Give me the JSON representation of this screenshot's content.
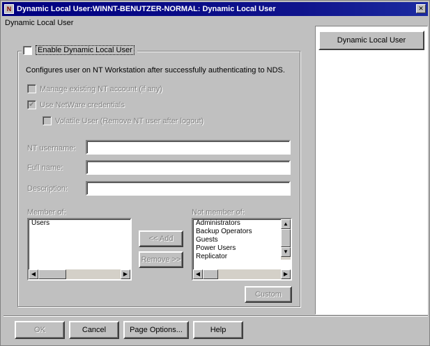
{
  "window": {
    "title": "Dynamic Local User:WINNT-BENUTZER-NORMAL: Dynamic Local User"
  },
  "panel": {
    "label": "Dynamic Local User"
  },
  "enable_checkbox": {
    "label": "Enable Dynamic Local User",
    "checked": false
  },
  "description": "Configures user on NT Workstation after successfully authenticating to NDS.",
  "options": {
    "manage_existing_label": "Manage existing NT account (if any)",
    "manage_existing_checked": false,
    "use_netware_label": "Use NetWare credentials",
    "use_netware_checked": true,
    "volatile_label": "Volatile User (Remove NT user after logout)",
    "volatile_checked": false
  },
  "fields": {
    "nt_username_label": "NT username:",
    "nt_username_value": "",
    "fullname_label": "Full name:",
    "fullname_value": "",
    "description_label": "Description:",
    "description_value": ""
  },
  "member_of": {
    "label": "Member of:",
    "items": [
      "Users"
    ]
  },
  "not_member_of": {
    "label": "Not member of:",
    "items": [
      "Administrators",
      "Backup Operators",
      "Guests",
      "Power Users",
      "Replicator"
    ]
  },
  "buttons": {
    "add": "<< Add",
    "remove": "Remove >>",
    "custom": "Custom",
    "ok": "OK",
    "cancel": "Cancel",
    "page_options": "Page Options...",
    "help": "Help"
  },
  "nav": {
    "items": [
      "Dynamic Local User"
    ]
  }
}
